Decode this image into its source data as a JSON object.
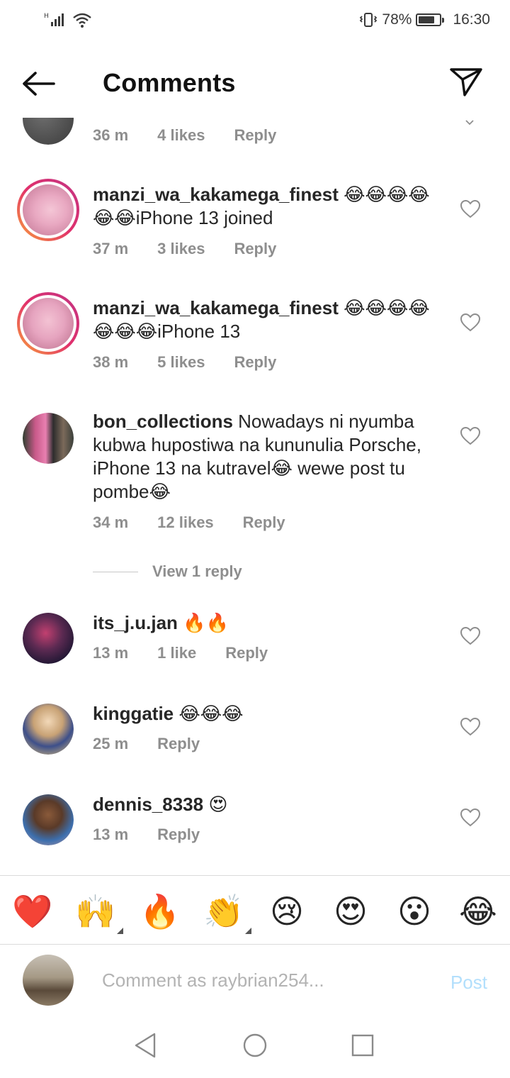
{
  "status_bar": {
    "battery_percent_text": "78%",
    "battery_level": 0.78,
    "time": "16:30",
    "icons": [
      "signal-icon",
      "wifi-icon",
      "vibrate-icon",
      "battery-icon"
    ]
  },
  "header": {
    "title": "Comments",
    "back_icon": "arrow-left-icon",
    "share_icon": "send-icon"
  },
  "comments": [
    {
      "username": "",
      "text": "",
      "time": "36 m",
      "likes": "4 likes",
      "reply": "Reply",
      "liked": false,
      "story_ring": false
    },
    {
      "username": "manzi_wa_kakamega_finest",
      "text": " 😂😂😂😂😂😂iPhone 13 joined",
      "time": "37 m",
      "likes": "3 likes",
      "reply": "Reply",
      "liked": false,
      "story_ring": true
    },
    {
      "username": "manzi_wa_kakamega_finest",
      "text": " 😂😂😂😂😂😂😂iPhone 13",
      "time": "38 m",
      "likes": "5 likes",
      "reply": "Reply",
      "liked": false,
      "story_ring": true
    },
    {
      "username": "bon_collections",
      "text": " Nowadays ni nyumba kubwa hupostiwa na kununulia Porsche, iPhone 13 na kutravel😂 wewe post tu pombe😂",
      "time": "34 m",
      "likes": "12 likes",
      "reply": "Reply",
      "liked": false,
      "story_ring": false,
      "view_replies": "View 1 reply"
    },
    {
      "username": "its_j.u.jan",
      "text": " 🔥🔥",
      "time": "13 m",
      "likes": "1 like",
      "reply": "Reply",
      "liked": false,
      "story_ring": false
    },
    {
      "username": "kinggatie",
      "text": " 😂😂😂",
      "time": "25 m",
      "likes": "",
      "reply": "Reply",
      "liked": false,
      "story_ring": false
    },
    {
      "username": "dennis_8338",
      "text": " 😍",
      "time": "13 m",
      "likes": "",
      "reply": "Reply",
      "liked": false,
      "story_ring": false
    }
  ],
  "emoji_bar": [
    "❤️",
    "🙌",
    "🔥",
    "👏",
    "😢",
    "😍",
    "😮",
    "😂"
  ],
  "input": {
    "placeholder": "Comment as raybrian254...",
    "value": "",
    "post_label": "Post"
  },
  "nav": {
    "icons": [
      "back-triangle-icon",
      "home-circle-icon",
      "recents-square-icon"
    ]
  },
  "colors": {
    "text": "#262626",
    "secondary": "#8e8e8e",
    "post_disabled": "#b2dffc",
    "heart_red": "#ed4956"
  }
}
